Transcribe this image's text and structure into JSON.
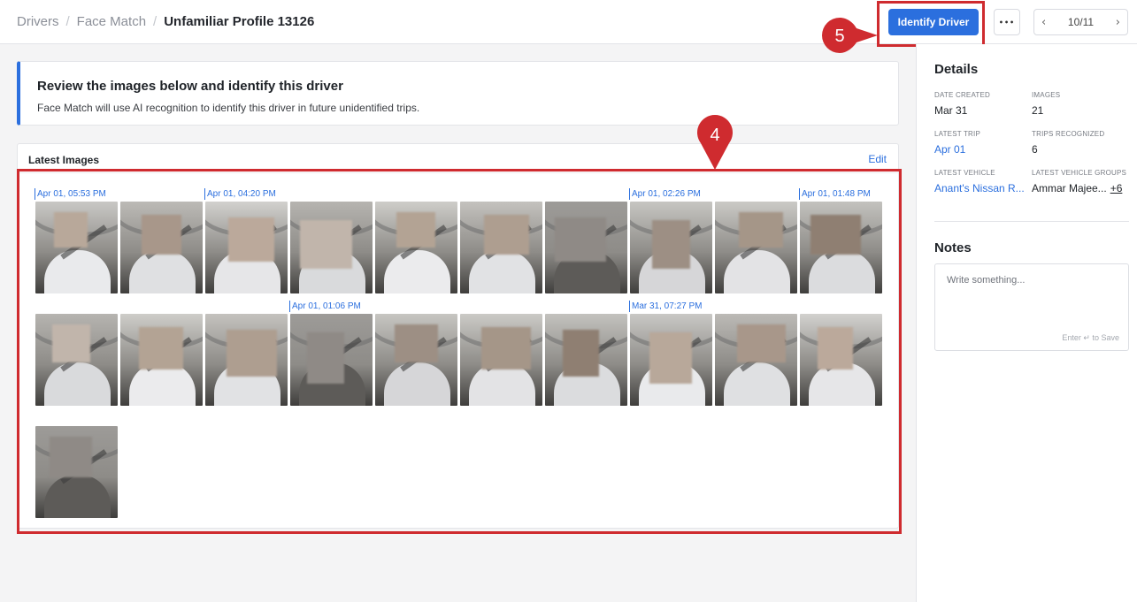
{
  "breadcrumb": {
    "items": [
      "Drivers",
      "Face Match"
    ],
    "current": "Unfamiliar Profile 13126"
  },
  "toolbar": {
    "identify_label": "Identify Driver",
    "more_label": "•••",
    "pager_prev": "‹",
    "pager_text": "10/11",
    "pager_next": "›"
  },
  "callouts": {
    "step5": "5",
    "step4": "4"
  },
  "banner": {
    "title": "Review the images below and identify this driver",
    "text": "Face Match will use AI recognition to identify this driver in future unidentified trips."
  },
  "images": {
    "title": "Latest Images",
    "edit_label": "Edit",
    "date_labels": [
      "Apr 01, 05:53 PM",
      "Apr 01, 04:20 PM",
      "Apr 01, 02:26 PM",
      "Apr 01, 01:48 PM",
      "Apr 01, 01:06 PM",
      "Mar 31, 07:27 PM"
    ]
  },
  "details": {
    "title": "Details",
    "date_created_label": "DATE CREATED",
    "date_created_value": "Mar 31",
    "images_label": "IMAGES",
    "images_value": "21",
    "latest_trip_label": "LATEST TRIP",
    "latest_trip_value": "Apr 01",
    "trips_recognized_label": "TRIPS RECOGNIZED",
    "trips_recognized_value": "6",
    "latest_vehicle_label": "LATEST VEHICLE",
    "latest_vehicle_value": "Anant's Nissan R...",
    "latest_vehicle_groups_label": "LATEST VEHICLE GROUPS",
    "latest_vehicle_groups_value": "Ammar Majee...",
    "latest_vehicle_groups_more": "+6"
  },
  "notes": {
    "title": "Notes",
    "placeholder": "Write something...",
    "hint": "Enter ↵ to Save"
  },
  "colors": {
    "accent": "#2b6fde",
    "callout": "#cf2b2f"
  }
}
